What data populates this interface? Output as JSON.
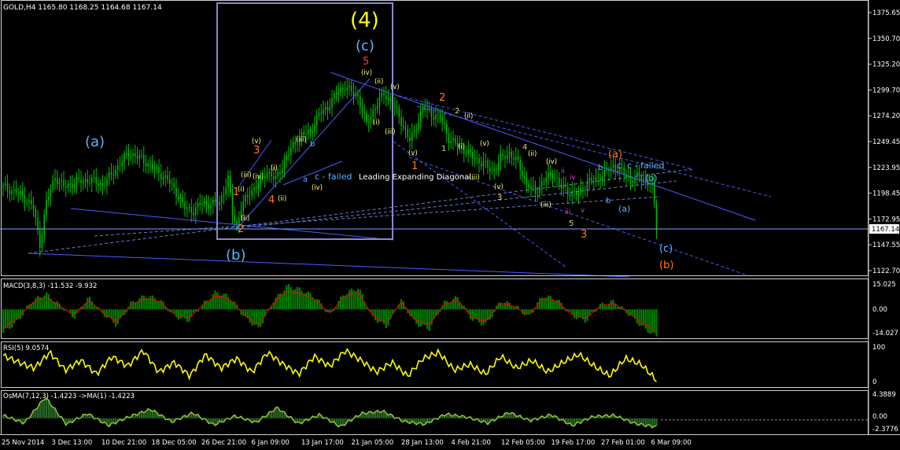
{
  "symbol_header": "GOLD,H4  1165.80 1168.25 1164.68 1167.14",
  "price_axis": [
    "1375.65",
    "1350.70",
    "1325.20",
    "1299.70",
    "1274.20",
    "1249.45",
    "1223.95",
    "1198.45",
    "1172.95",
    "1147.55",
    "1122.70"
  ],
  "current_price": "1167.14",
  "time_axis": [
    "25 Nov 2014",
    "3 Dec 13:00",
    "10 Dec 21:00",
    "18 Dec 05:00",
    "26 Dec 21:00",
    "6 Jan 09:00",
    "13 Jan 17:00",
    "21 Jan 05:00",
    "28 Jan 13:00",
    "4 Feb 21:00",
    "12 Feb 05:00",
    "19 Feb 17:00",
    "27 Feb 01:00",
    "6 Mar 09:00"
  ],
  "macd": {
    "label": "MACD(3,8,3) -11.532 -9.932",
    "axis": [
      "15.025",
      "0.00",
      "-14.027"
    ]
  },
  "rsi": {
    "label": "RSI(5) 9.0574",
    "axis": [
      "100",
      "0"
    ]
  },
  "osma": {
    "label": "OsMA(7,12,3) -1.4223  ->MA(1) -1.4223",
    "axis": [
      "4.3889",
      "0.00",
      "-2.3776"
    ]
  },
  "annotations": {
    "wave4": "(4)",
    "c_top": "(c)",
    "a_left": "(a)",
    "b_left": "(b)",
    "five_top": "5",
    "c_failed_1": "c - failed",
    "c_failed_2": "c - failed",
    "leading": "Leading Expanding Diagonal",
    "a_orange": "(a)",
    "b_right": "(b)",
    "a_right": "(a)",
    "c_bottom": "(c)",
    "b_bottom": "(b)",
    "r3": "3",
    "r2": "2",
    "r4": "4",
    "r1": "1",
    "r1b": "1",
    "r2b": "2",
    "r3b": "3",
    "y5": "5",
    "y3": "3",
    "y4": "4",
    "y2": "2",
    "y1": "1",
    "ia": "a",
    "ib": "b",
    "ic": "c",
    "ib2": "b"
  },
  "colors": {
    "bg": "#000000",
    "candle": "#00c000",
    "macd_hist": "#008000",
    "signal": "#ff0000",
    "rsi": "#ffff00",
    "osma": "#9acd32",
    "lines": "#4a5cff",
    "box": "#8888cc"
  },
  "chart_data": {
    "type": "candlestick",
    "symbol": "GOLD",
    "timeframe": "H4",
    "close_path": [
      [
        0,
        1205
      ],
      [
        6,
        1200
      ],
      [
        10,
        1195
      ],
      [
        14,
        1185
      ],
      [
        17,
        1150
      ],
      [
        20,
        1190
      ],
      [
        24,
        1215
      ],
      [
        28,
        1205
      ],
      [
        34,
        1210
      ],
      [
        40,
        1212
      ],
      [
        46,
        1207
      ],
      [
        52,
        1222
      ],
      [
        58,
        1238
      ],
      [
        64,
        1232
      ],
      [
        70,
        1222
      ],
      [
        76,
        1212
      ],
      [
        80,
        1200
      ],
      [
        84,
        1185
      ],
      [
        88,
        1182
      ],
      [
        92,
        1190
      ],
      [
        96,
        1188
      ],
      [
        100,
        1190
      ],
      [
        104,
        1212
      ],
      [
        106,
        1180
      ],
      [
        108,
        1168
      ],
      [
        110,
        1185
      ],
      [
        114,
        1200
      ],
      [
        118,
        1208
      ],
      [
        122,
        1220
      ],
      [
        126,
        1212
      ],
      [
        130,
        1230
      ],
      [
        134,
        1245
      ],
      [
        138,
        1255
      ],
      [
        142,
        1258
      ],
      [
        146,
        1275
      ],
      [
        150,
        1282
      ],
      [
        154,
        1295
      ],
      [
        158,
        1302
      ],
      [
        160,
        1298
      ],
      [
        164,
        1292
      ],
      [
        168,
        1265
      ],
      [
        172,
        1282
      ],
      [
        176,
        1295
      ],
      [
        180,
        1285
      ],
      [
        184,
        1268
      ],
      [
        188,
        1250
      ],
      [
        190,
        1258
      ],
      [
        194,
        1282
      ],
      [
        198,
        1275
      ],
      [
        202,
        1272
      ],
      [
        206,
        1252
      ],
      [
        210,
        1245
      ],
      [
        214,
        1240
      ],
      [
        218,
        1232
      ],
      [
        222,
        1228
      ],
      [
        226,
        1220
      ],
      [
        230,
        1232
      ],
      [
        234,
        1238
      ],
      [
        238,
        1228
      ],
      [
        242,
        1208
      ],
      [
        246,
        1200
      ],
      [
        250,
        1212
      ],
      [
        254,
        1218
      ],
      [
        258,
        1205
      ],
      [
        262,
        1200
      ],
      [
        266,
        1198
      ],
      [
        270,
        1210
      ],
      [
        274,
        1212
      ],
      [
        278,
        1218
      ],
      [
        282,
        1225
      ],
      [
        286,
        1220
      ],
      [
        290,
        1212
      ],
      [
        294,
        1215
      ],
      [
        298,
        1210
      ],
      [
        300,
        1205
      ],
      [
        302,
        1167
      ]
    ],
    "macd_values": [
      -12,
      -6,
      4,
      8,
      2,
      -4,
      6,
      -2,
      -8,
      3,
      7,
      5,
      -3,
      -6,
      2,
      9,
      6,
      -4,
      -10,
      4,
      12,
      10,
      6,
      -3,
      8,
      11,
      -4,
      -9,
      5,
      -7,
      -10,
      3,
      6,
      -5,
      -8,
      4,
      2,
      -4,
      7,
      5,
      -3,
      -6,
      2,
      4,
      -2,
      -9,
      -14
    ],
    "rsi_values": [
      72,
      55,
      40,
      80,
      35,
      60,
      25,
      70,
      45,
      85,
      30,
      55,
      20,
      75,
      40,
      65,
      30,
      80,
      50,
      25,
      70,
      45,
      85,
      60,
      30,
      55,
      20,
      65,
      80,
      35,
      50,
      25,
      70,
      40,
      60,
      30,
      55,
      75,
      45,
      20,
      65,
      50,
      9
    ],
    "osma_values": [
      0.5,
      -0.8,
      3.5,
      -1,
      0.8,
      -1.2,
      0.3,
      1.5,
      -0.6,
      0.9,
      -1.1,
      0.4,
      -0.7,
      1.8,
      -0.9,
      0.6,
      -1.4,
      0.8,
      1.2,
      -0.5,
      -1,
      0.7,
      0.2,
      -0.8,
      1.0,
      -0.4,
      0.6,
      -1.2,
      0.3,
      0.5,
      -0.9,
      -1.42
    ]
  }
}
